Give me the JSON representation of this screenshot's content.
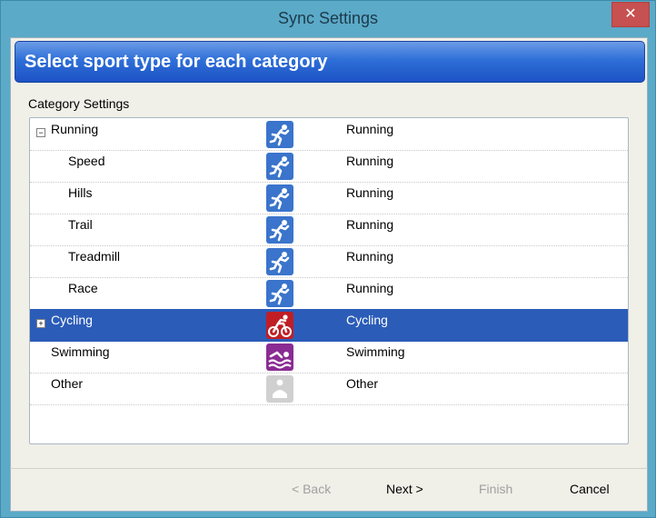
{
  "window": {
    "title": "Sync Settings",
    "close_label": "✕"
  },
  "banner": {
    "text": "Select sport type for each category"
  },
  "group": {
    "label": "Category Settings"
  },
  "rows": [
    {
      "name": "Running",
      "sport": "Running",
      "icon": "running-icon",
      "expander": "−"
    },
    {
      "name": "Speed",
      "sport": "Running",
      "icon": "running-icon"
    },
    {
      "name": "Hills",
      "sport": "Running",
      "icon": "running-icon"
    },
    {
      "name": "Trail",
      "sport": "Running",
      "icon": "running-icon"
    },
    {
      "name": "Treadmill",
      "sport": "Running",
      "icon": "running-icon"
    },
    {
      "name": "Race",
      "sport": "Running",
      "icon": "running-icon"
    },
    {
      "name": "Cycling",
      "sport": "Cycling",
      "icon": "cycling-icon",
      "expander": "+"
    },
    {
      "name": "Swimming",
      "sport": "Swimming",
      "icon": "swimming-icon"
    },
    {
      "name": "Other",
      "sport": "Other",
      "icon": "other-icon"
    }
  ],
  "buttons": {
    "back": "< Back",
    "next": "Next >",
    "finish": "Finish",
    "cancel": "Cancel"
  },
  "colors": {
    "running": "#3a74cc",
    "cycling": "#c01e24",
    "swimming": "#8a2c93",
    "other": "#d0d0d0",
    "selection": "#2b5cb8"
  }
}
